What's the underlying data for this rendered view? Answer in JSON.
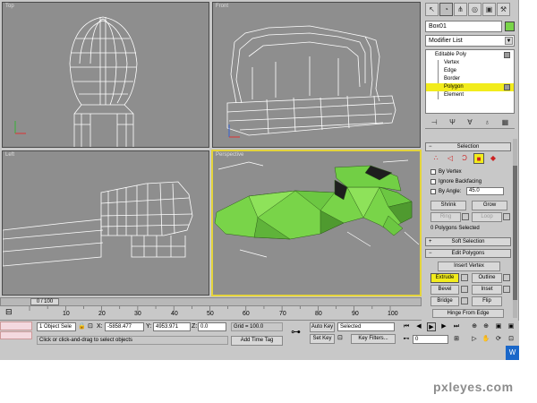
{
  "viewports": {
    "top": "Top",
    "front": "Front",
    "left": "Left",
    "perspective": "Perspective"
  },
  "command_panel": {
    "object_name": "Box01",
    "object_color": "#79d449",
    "modifier_list": "Modifier List",
    "stack": {
      "root": "Editable Poly",
      "items": [
        "Vertex",
        "Edge",
        "Border",
        "Polygon",
        "Element"
      ],
      "selected": "Polygon"
    },
    "selection_rollout": "Selection",
    "by_vertex": "By Vertex",
    "ignore_backfacing": "Ignore Backfacing",
    "by_angle": "By Angle:",
    "angle_value": "45.0",
    "shrink": "Shrink",
    "grow": "Grow",
    "ring": "Ring",
    "loop": "Loop",
    "selected_info": "0 Polygons Selected",
    "soft_selection": "Soft Selection",
    "edit_polygons": "Edit Polygons",
    "insert_vertex": "Insert Vertex",
    "extrude": "Extrude",
    "outline": "Outline",
    "bevel": "Bevel",
    "inset": "Inset",
    "bridge": "Bridge",
    "flip": "Flip",
    "hinge": "Hinge From Edge"
  },
  "timeline": {
    "frame_label": "0 / 100",
    "ticks": [
      "10",
      "20",
      "30",
      "40",
      "50",
      "60",
      "70",
      "80",
      "90",
      "100"
    ]
  },
  "status": {
    "objects": "1 Object Sele",
    "prompt": "Click or click-and-drag to select objects",
    "x_label": "X:",
    "x_value": "-5858.477",
    "y_label": "Y:",
    "y_value": "4953.971",
    "z_label": "Z:",
    "z_value": "0.0",
    "grid": "Grid = 100.0",
    "add_time_tag": "Add Time Tag",
    "auto_key": "Auto Key",
    "set_key": "Set Key",
    "key_mode": "Selected",
    "key_filters": "Key Filters...",
    "frame": "0"
  },
  "watermark": "pxleyes.com",
  "colors": {
    "viewport_bg": "#8e8e8e",
    "wireframe": "#ffffff",
    "mesh": "#7ad64a",
    "highlight": "#f2ec1c",
    "active_border": "#e4d43c"
  }
}
